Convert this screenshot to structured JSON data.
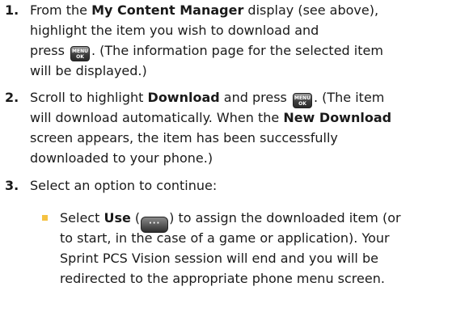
{
  "steps": [
    {
      "number": "1.",
      "lines": [
        [
          "From the ",
          "My Content Manager",
          " display (see above),"
        ],
        [
          "highlight the item you wish to download and"
        ],
        [
          "press ",
          ". (The information page for the selected item"
        ],
        [
          "will be displayed.)"
        ]
      ]
    },
    {
      "number": "2.",
      "lines": [
        [
          "Scroll to highlight ",
          "Download",
          " and press ",
          ". (The item"
        ],
        [
          "will download automatically. When the ",
          "New Download"
        ],
        [
          "screen appears, the item has been successfully"
        ],
        [
          "downloaded to your phone.)"
        ]
      ]
    },
    {
      "number": "3.",
      "lines": [
        [
          "Select an option to continue:"
        ]
      ]
    }
  ],
  "sub_bullet": {
    "lines": [
      [
        "Select ",
        "Use",
        " (",
        ") to assign the downloaded item (or"
      ],
      [
        "to start, in the case of a game or application). Your"
      ],
      [
        "Sprint PCS Vision session will end and you will be"
      ],
      [
        "redirected to the appropriate phone menu screen."
      ]
    ]
  },
  "menu_ok_key": {
    "top": "MENU",
    "bottom": "OK",
    "icon": "menu-ok-key-icon"
  },
  "softkey_icon": {
    "text": "···",
    "icon": "left-softkey-icon"
  },
  "colors": {
    "bullet": "#f5c242",
    "text": "#1a1a1a"
  }
}
